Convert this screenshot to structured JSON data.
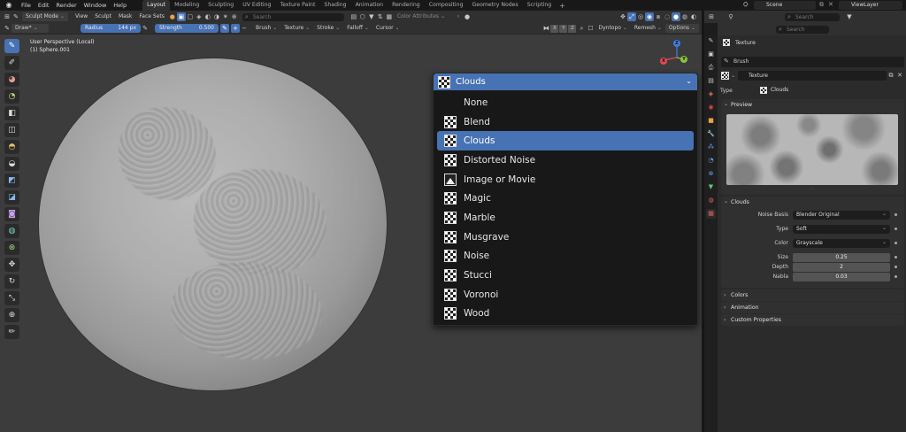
{
  "menu": [
    "File",
    "Edit",
    "Render",
    "Window",
    "Help"
  ],
  "workspaces": [
    "Layout",
    "Modeling",
    "Sculpting",
    "UV Editing",
    "Texture Paint",
    "Shading",
    "Animation",
    "Rendering",
    "Compositing",
    "Geometry Nodes",
    "Scripting"
  ],
  "active_workspace": "Layout",
  "scene": "Scene",
  "view_layer": "ViewLayer",
  "header": {
    "mode": "Sculpt Mode",
    "view": "View",
    "sculpt": "Sculpt",
    "mask": "Mask",
    "face_sets": "Face Sets",
    "search_placeholder": "Search",
    "color_attributes": "Color Attributes"
  },
  "tool_settings": {
    "brush": "Draw*",
    "radius_label": "Radius",
    "radius_value": "144 px",
    "strength_label": "Strength",
    "strength_value": "0.500",
    "brush_menu": "Brush",
    "texture_menu": "Texture",
    "stroke_menu": "Stroke",
    "falloff_menu": "Falloff",
    "cursor_menu": "Cursor",
    "axes": [
      "X",
      "Y",
      "Z"
    ],
    "dyntopo": "Dyntopo",
    "remesh": "Remesh",
    "options": "Options"
  },
  "viewport": {
    "perspective": "User Perspective (Local)",
    "object": "(1) Sphere.001"
  },
  "dropdown": {
    "current": "Clouds",
    "items": [
      {
        "label": "None",
        "icon": "none"
      },
      {
        "label": "Blend",
        "icon": "checker"
      },
      {
        "label": "Clouds",
        "icon": "checker",
        "selected": true
      },
      {
        "label": "Distorted Noise",
        "icon": "checker"
      },
      {
        "label": "Image or Movie",
        "icon": "image"
      },
      {
        "label": "Magic",
        "icon": "checker"
      },
      {
        "label": "Marble",
        "icon": "checker"
      },
      {
        "label": "Musgrave",
        "icon": "checker"
      },
      {
        "label": "Noise",
        "icon": "checker"
      },
      {
        "label": "Stucci",
        "icon": "checker"
      },
      {
        "label": "Voronoi",
        "icon": "checker"
      },
      {
        "label": "Wood",
        "icon": "checker"
      }
    ]
  },
  "properties": {
    "search_placeholder": "Search",
    "breadcrumb": "Texture",
    "brush_label": "Brush",
    "texture_name": "Texture",
    "type_label": "Type",
    "type_value": "Clouds",
    "preview_title": "Preview",
    "clouds_title": "Clouds",
    "noise_basis_label": "Noise Basis",
    "noise_basis_value": "Blender Original",
    "noise_type_label": "Type",
    "noise_type_value": "Soft",
    "color_label": "Color",
    "color_value": "Grayscale",
    "size_label": "Size",
    "size_value": "0.25",
    "depth_label": "Depth",
    "depth_value": "2",
    "nabla_label": "Nabla",
    "nabla_value": "0.03",
    "colors_title": "Colors",
    "animation_title": "Animation",
    "custom_props_title": "Custom Properties"
  },
  "colors": {
    "accent": "#4772b3",
    "axis_x": "#e84855",
    "axis_y": "#8bc43f",
    "axis_z": "#3b7fe8"
  }
}
